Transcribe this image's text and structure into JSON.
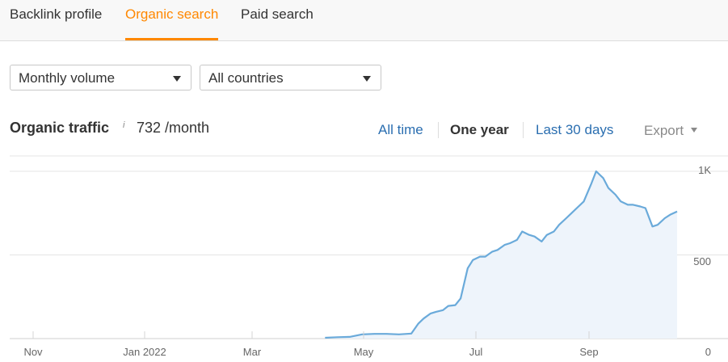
{
  "tabs": [
    {
      "label": "Backlink profile",
      "active": false
    },
    {
      "label": "Organic search",
      "active": true
    },
    {
      "label": "Paid search",
      "active": false
    }
  ],
  "filters": {
    "metric": "Monthly volume",
    "country": "All countries"
  },
  "metric": {
    "title": "Organic traffic",
    "info": "i",
    "value": "732 /month"
  },
  "ranges": {
    "all_time": "All time",
    "one_year": "One year",
    "last_30_days": "Last 30 days",
    "selected": "One year"
  },
  "export_label": "Export",
  "colors": {
    "accent": "#ff8800",
    "link": "#2a6eb0",
    "line": "#6aaada",
    "area": "#eef4fb"
  },
  "chart_data": {
    "type": "area",
    "x_tick_labels": [
      "Nov",
      "Jan 2022",
      "Mar",
      "May",
      "Jul",
      "Sep"
    ],
    "y_tick_labels": [
      "0",
      "500",
      "1K"
    ],
    "ylim": [
      0,
      1000
    ],
    "grid": true,
    "x": [
      "2021-10-24",
      "2022-02-20",
      "2022-03-20",
      "2022-04-03",
      "2022-04-10",
      "2022-04-17",
      "2022-04-24",
      "2022-05-01",
      "2022-05-08",
      "2022-05-15",
      "2022-05-22",
      "2022-05-26",
      "2022-05-29",
      "2022-06-02",
      "2022-06-05",
      "2022-06-09",
      "2022-06-12",
      "2022-06-16",
      "2022-06-19",
      "2022-06-23",
      "2022-06-26",
      "2022-06-30",
      "2022-07-03",
      "2022-07-07",
      "2022-07-10",
      "2022-07-14",
      "2022-07-17",
      "2022-07-21",
      "2022-07-24",
      "2022-07-28",
      "2022-07-31",
      "2022-08-04",
      "2022-08-07",
      "2022-08-11",
      "2022-08-14",
      "2022-08-18",
      "2022-08-21",
      "2022-08-25",
      "2022-08-28",
      "2022-09-01",
      "2022-09-04",
      "2022-09-08",
      "2022-09-11",
      "2022-09-15",
      "2022-09-18",
      "2022-09-22",
      "2022-09-25",
      "2022-09-29",
      "2022-10-02",
      "2022-10-06",
      "2022-10-09",
      "2022-10-13",
      "2022-10-16",
      "2022-10-20"
    ],
    "series": [
      {
        "values": [
          null,
          null,
          null,
          5,
          8,
          10,
          25,
          28,
          28,
          25,
          30,
          90,
          120,
          150,
          160,
          170,
          195,
          200,
          240,
          420,
          470,
          490,
          490,
          520,
          530,
          560,
          570,
          590,
          640,
          620,
          610,
          580,
          620,
          640,
          680,
          720,
          750,
          790,
          820,
          920,
          1000,
          960,
          900,
          860,
          820,
          800,
          800,
          790,
          780,
          670,
          680,
          720,
          740,
          760
        ]
      }
    ]
  }
}
